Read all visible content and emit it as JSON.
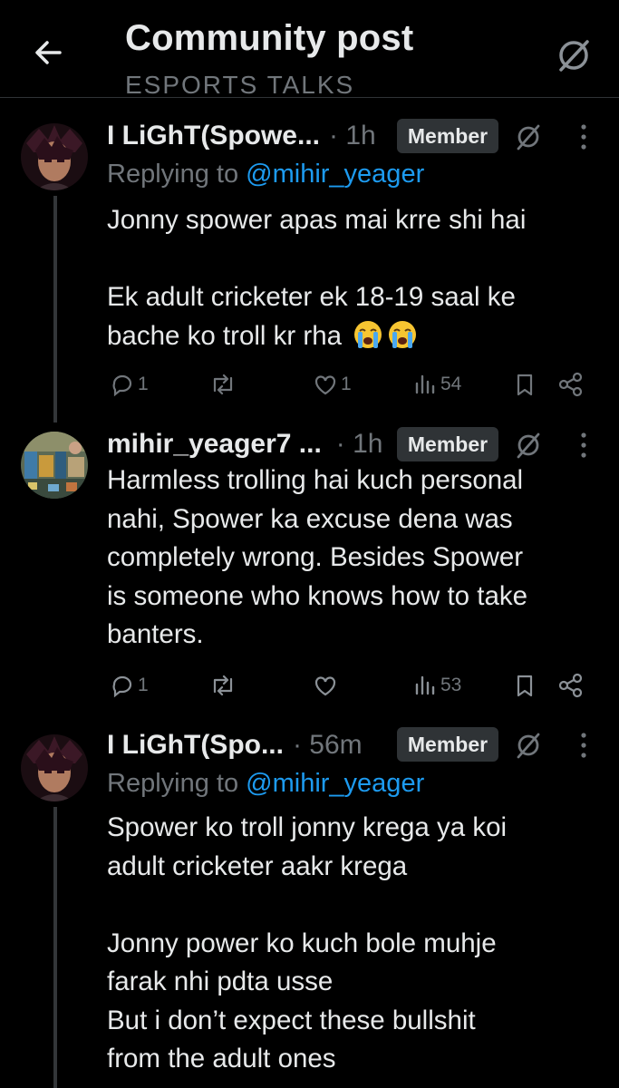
{
  "header": {
    "title": "Community post",
    "subtitle": "ESPORTS TALKS"
  },
  "colors": {
    "background": "#000000",
    "text": "#e7e9ea",
    "muted": "#71767b",
    "link": "#1d9bf0",
    "badge_bg": "#2f3336"
  },
  "posts": [
    {
      "name": "I LiGhT(Spowe...",
      "time": "· 1h",
      "badge": "Member",
      "reply_prefix": "Replying to",
      "reply_handle": "@mihir_yeager",
      "lines": [
        "Jonny spower apas mai krre shi hai",
        "",
        "Ek adult cricketer ek 18-19 saal ke",
        "bache ko troll kr rha"
      ],
      "replies": "1",
      "retweets": "",
      "likes": "1",
      "views": "54"
    },
    {
      "name": "mihir_yeager7 ...",
      "time": "· 1h",
      "badge": "Member",
      "lines": [
        "Harmless trolling hai kuch personal",
        "nahi, Spower ka excuse dena was",
        "completely wrong. Besides Spower",
        "is someone who knows how to take",
        "banters."
      ],
      "replies": "1",
      "retweets": "",
      "likes": "",
      "views": "53"
    },
    {
      "name": "I LiGhT(Spo...",
      "time": "· 56m",
      "badge": "Member",
      "reply_prefix": "Replying to",
      "reply_handle": "@mihir_yeager",
      "lines": [
        "Spower ko troll jonny krega ya koi",
        "adult cricketer aakr krega",
        "",
        "Jonny power ko kuch bole muhje",
        "farak nhi pdta usse",
        "But i don’t expect these bullshit",
        "from the adult ones"
      ]
    }
  ]
}
